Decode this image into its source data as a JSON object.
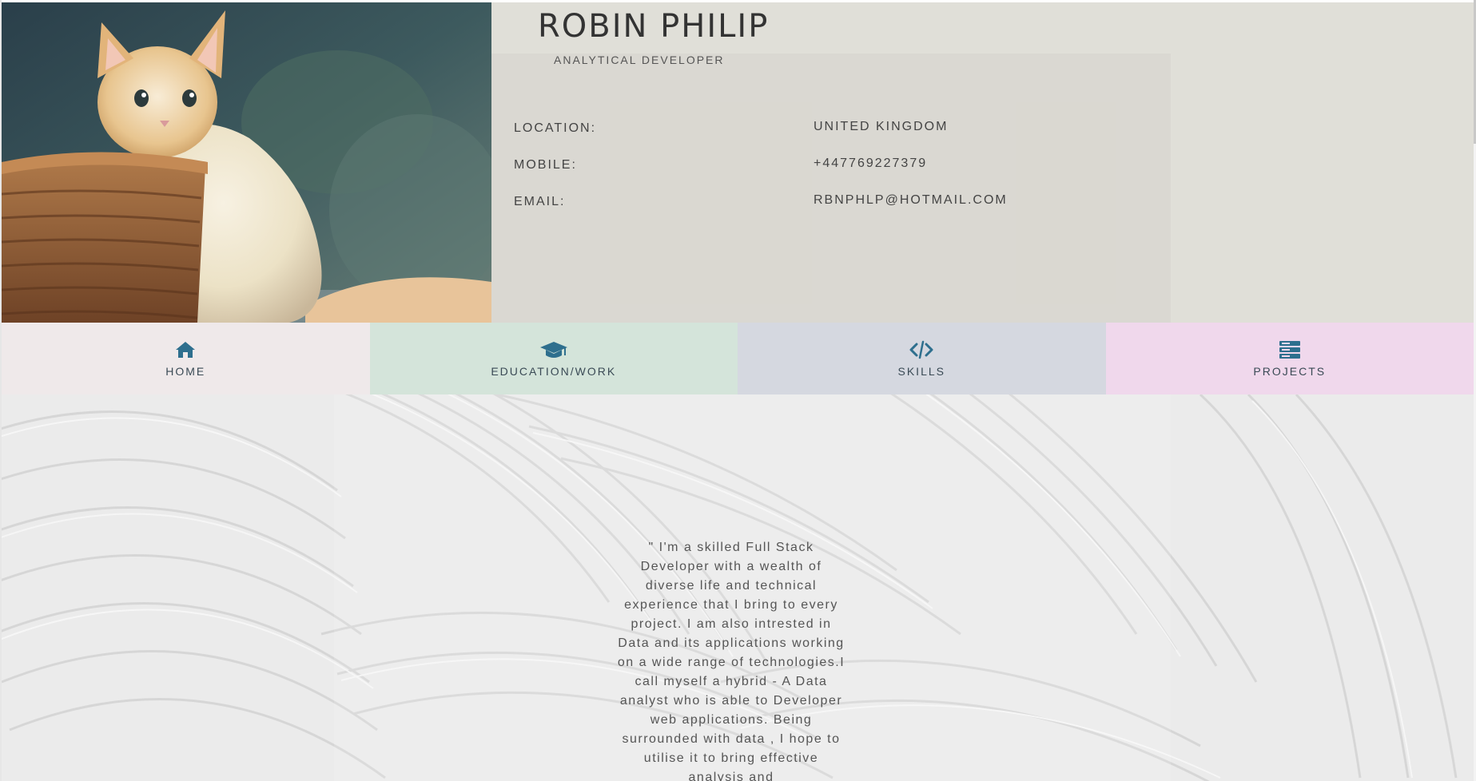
{
  "header": {
    "name": "ROBIN PHILIP",
    "role": "ANALYTICAL DEVELOPER",
    "info": [
      {
        "label": "LOCATION:",
        "value": "UNITED KINGDOM"
      },
      {
        "label": "MOBILE:",
        "value": "+447769227379"
      },
      {
        "label": "EMAIL:",
        "value": "RBNPHLP@HOTMAIL.COM"
      }
    ],
    "photo_icon": "kitten-photo"
  },
  "nav": {
    "tabs": [
      {
        "label": "HOME",
        "icon": "home-icon",
        "color": "#efe9ea"
      },
      {
        "label": "EDUCATION/WORK",
        "icon": "graduation-cap-icon",
        "color": "#d4e4da"
      },
      {
        "label": "SKILLS",
        "icon": "code-icon",
        "color": "#d5d8e0"
      },
      {
        "label": "PROJECTS",
        "icon": "server-icon",
        "color": "#f0d8ec"
      }
    ],
    "icon_color": "#2e6f8e"
  },
  "main": {
    "quote": "\" I'm a skilled Full Stack Developer with a wealth of diverse life and technical experience that I bring to every project. I am also intrested in Data and its applications working on a wide range of technologies.I call myself a hybrid - A Data analyst who is able to Developer web applications. Being surrounded with data , I hope to utilise it to bring effective analysis and"
  }
}
